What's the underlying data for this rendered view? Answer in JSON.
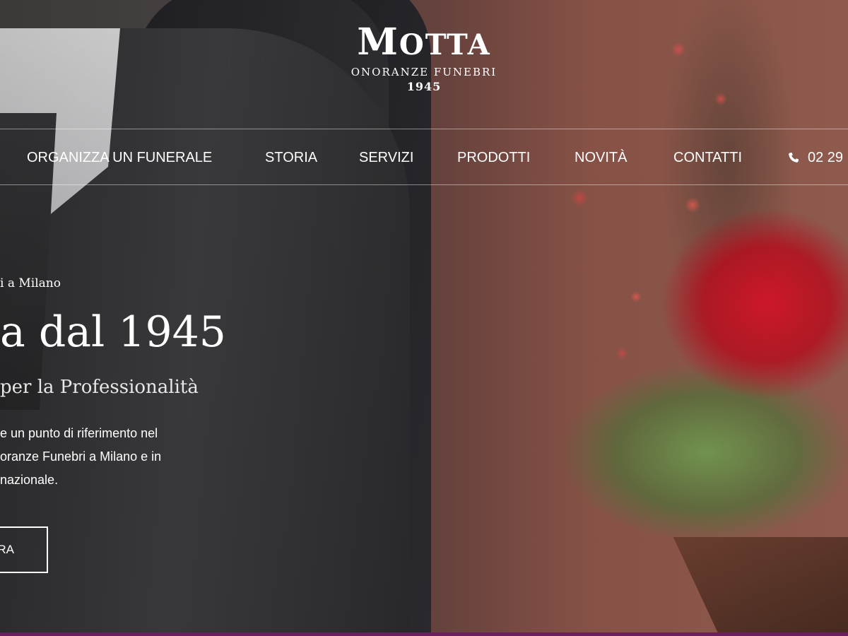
{
  "logo": {
    "name_initial": "M",
    "name_rest": "OTTA",
    "subtitle": "ONORANZE FUNEBRI",
    "year": "1945"
  },
  "nav": {
    "items": [
      {
        "label": "ORGANIZZA UN FUNERALE"
      },
      {
        "label": "STORIA"
      },
      {
        "label": "SERVIZI"
      },
      {
        "label": "PRODOTTI"
      },
      {
        "label": "NOVITÀ"
      },
      {
        "label": "CONTATTI"
      }
    ],
    "phone": {
      "icon": "phone-icon",
      "text": "02 29"
    }
  },
  "hero": {
    "kicker": "i a Milano",
    "headline": "a dal 1945",
    "subheadline": "per la Professionalità",
    "body_lines": [
      "e un punto di riferimento nel",
      "oranze Funebri a Milano e in",
      "nazionale."
    ],
    "cta_label": "RA"
  },
  "colors": {
    "bottom_bar": "#6b1f5e",
    "text": "#ffffff"
  }
}
